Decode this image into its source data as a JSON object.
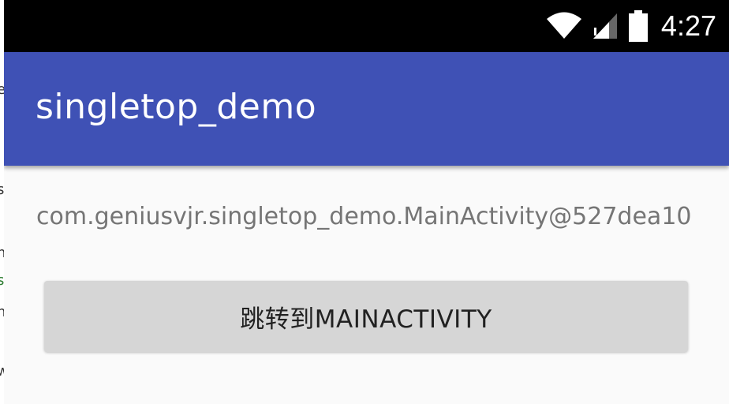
{
  "status_bar": {
    "time": "4:27",
    "icons": [
      "wifi-icon",
      "cell-signal-icon",
      "battery-icon"
    ],
    "background": "#000000"
  },
  "app_bar": {
    "title": "singletop_demo",
    "color": "#3F51B5"
  },
  "content": {
    "activity_text": "com.geniusvjr.singletop_demo.MainActivity@527dea10",
    "button_label": "跳转到MAINACTIVITY",
    "background": "#fafafa",
    "button_color": "#d6d6d6"
  },
  "background_window": {
    "fragments": [
      "e",
      "s",
      "n",
      "s",
      "n",
      "w"
    ]
  }
}
